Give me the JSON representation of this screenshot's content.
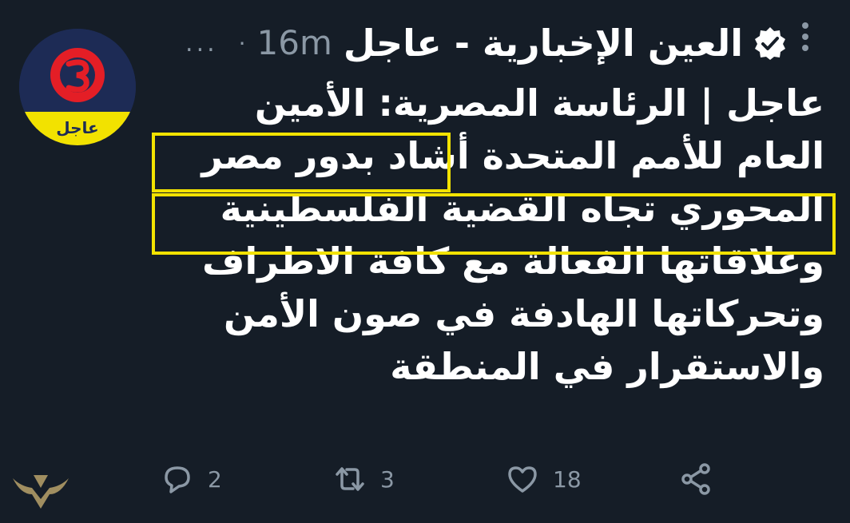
{
  "tweet": {
    "author_line1": "العين الإخبارية - عاجل",
    "more_dots": "...",
    "separator": "·",
    "time": "16m",
    "lines": [
      "عاجل | الرئاسة المصرية: الأمين",
      "العام للأمم المتحدة أشاد بدور مصر",
      "المحوري تجاه القضية الفلسطينية",
      "وعلاقاتها الفعالة مع كافة الاطراف",
      "وتحركاتها الهادفة في صون الأمن",
      "والاستقرار في المنطقة"
    ]
  },
  "avatar": {
    "label": "عاجل",
    "colors": {
      "ring": "#e41e26",
      "bg": "#1d2b55",
      "band": "#f2e200"
    }
  },
  "actions": {
    "reply_count": "2",
    "retweet_count": "3",
    "like_count": "18"
  },
  "icons": [
    "reply-icon",
    "retweet-icon",
    "like-icon",
    "share-icon",
    "verified-icon",
    "more-icon"
  ],
  "colors": {
    "background": "#151d27",
    "text": "#ffffff",
    "muted": "#8b98a5",
    "highlight": "#f2e200"
  }
}
